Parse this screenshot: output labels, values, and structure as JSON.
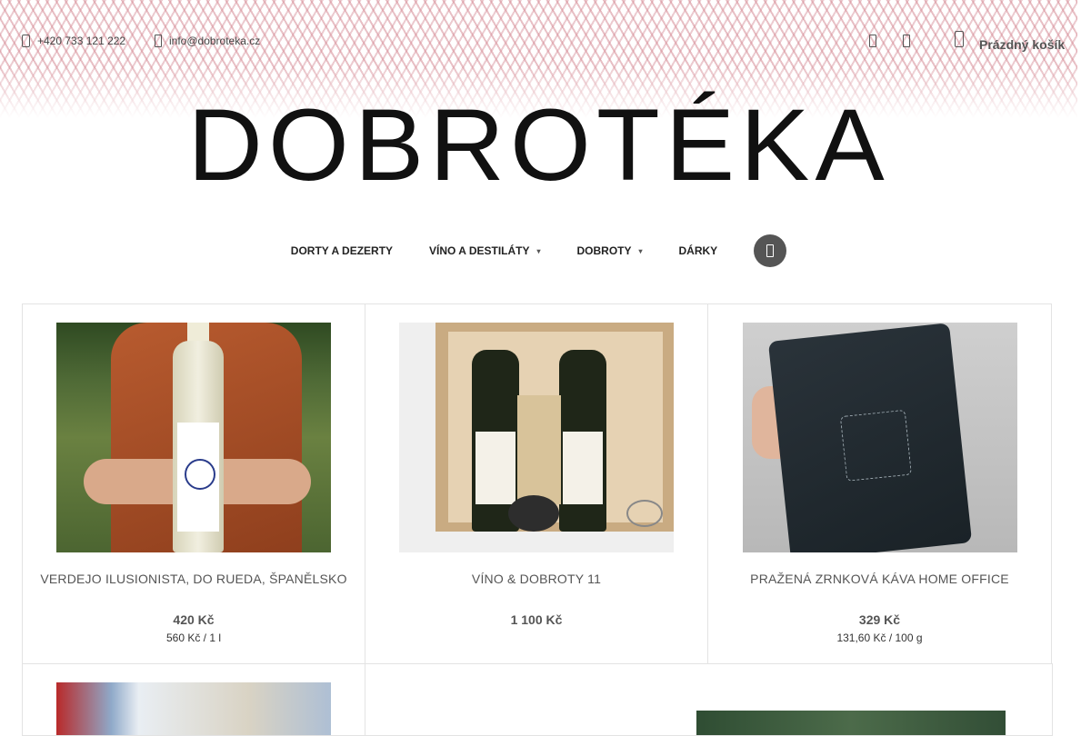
{
  "header": {
    "phone": "+420 733 121 222",
    "email": "info@dobroteka.cz",
    "cart_label": "Prázdný košík",
    "icons": [
      "phone-icon",
      "mail-icon",
      "facebook-icon",
      "instagram-icon",
      "cart-icon"
    ]
  },
  "logo": {
    "text": "DOBROTÉKA"
  },
  "nav": {
    "items": [
      {
        "label": "DORTY A DEZERTY",
        "has_dropdown": false
      },
      {
        "label": "VÍNO A DESTILÁTY",
        "has_dropdown": true
      },
      {
        "label": "DOBROTY",
        "has_dropdown": true
      },
      {
        "label": "DÁRKY",
        "has_dropdown": false
      }
    ],
    "search_icon": "search-icon"
  },
  "products": [
    {
      "name": "VERDEJO ILUSIONISTA, DO RUEDA, ŠPANĚLSKO",
      "price": "420 Kč",
      "unit_price": "560 Kč / 1 l"
    },
    {
      "name": "VÍNO & DOBROTY 11",
      "price": "1 100 Kč",
      "unit_price": ""
    },
    {
      "name": "PRAŽENÁ ZRNKOVÁ KÁVA HOME OFFICE",
      "price": "329 Kč",
      "unit_price": "131,60 Kč / 100 g"
    }
  ],
  "colors": {
    "pattern": "#d68c96",
    "text": "#555555",
    "search_button": "#555555"
  }
}
